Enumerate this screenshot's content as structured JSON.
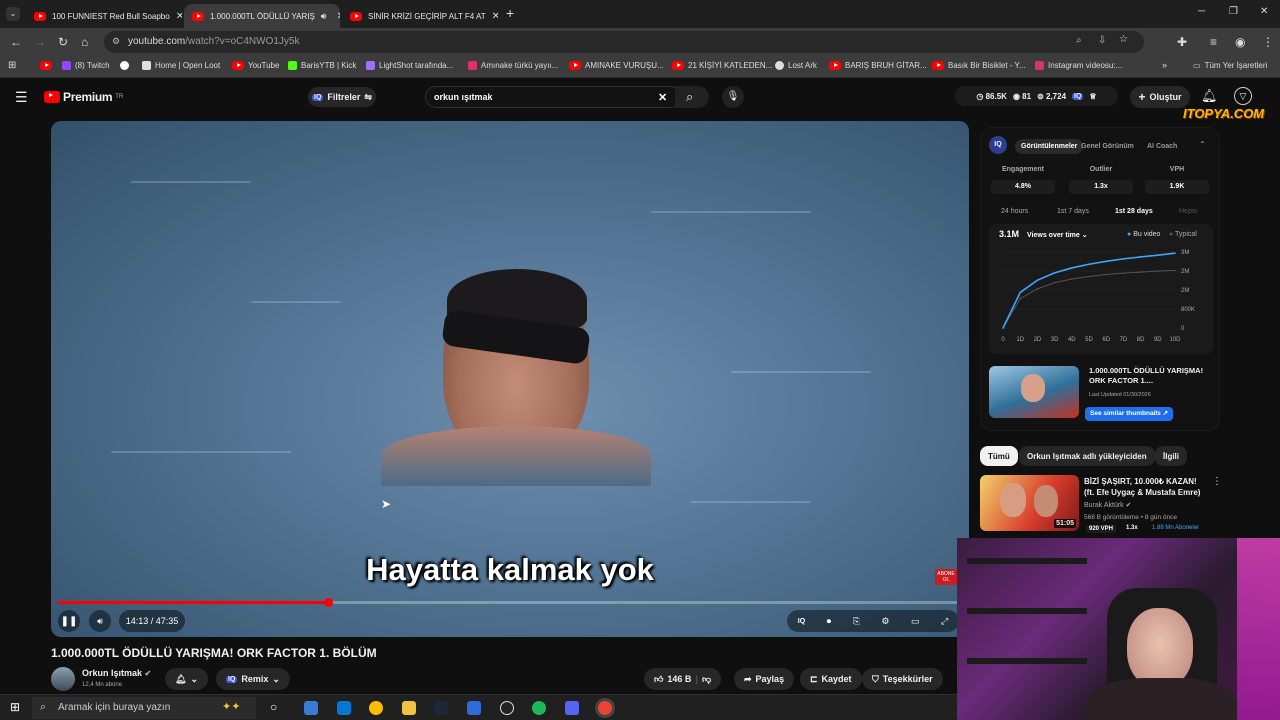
{
  "browser": {
    "tabs": [
      {
        "label": "100 FUNNIEST Red Bull Soapbo"
      },
      {
        "label": "1.000.000TL ÖDÜLLÜ YARIŞ"
      },
      {
        "label": "SİNİR KRİZİ GEÇİRİP ALT F4 AT"
      }
    ],
    "new_tab": "+",
    "url_host": "youtube.com",
    "url_path": "/watch?v=oC4NWO1Jy5k",
    "bookmarks": [
      {
        "label": "(8) Twitch",
        "color": "#9146ff"
      },
      {
        "label": "",
        "color": "#ffffff"
      },
      {
        "label": "Home | Open Loot",
        "color": "#dddddd"
      },
      {
        "label": "YouTube",
        "color": "#ff0000"
      },
      {
        "label": "BarisYTB | Kick",
        "color": "#53fc18"
      },
      {
        "label": "LightShot tarafında...",
        "color": "#a070ff"
      },
      {
        "label": "Amınake türkü yayıı...",
        "color": "#e1306c"
      },
      {
        "label": "AMINAKE VURUŞU...",
        "color": "#ff0000"
      },
      {
        "label": "21 KİŞİYİ KATLEDEN...",
        "color": "#ff0000"
      },
      {
        "label": "Lost Ark",
        "color": "#dddddd"
      },
      {
        "label": "BARIŞ BRUH GİTAR...",
        "color": "#ff0000"
      },
      {
        "label": "Basık Bir Bisiklet - Y...",
        "color": "#ff0000"
      },
      {
        "label": "Instagram videosu:...",
        "color": "#e1306c"
      }
    ],
    "all_bookmarks": "Tüm Yer İşaretleri"
  },
  "youtube": {
    "logo": "Premium",
    "logo_sup": "TR",
    "filters_label": "Filtreler",
    "search_value": "orkun ışıtmak",
    "stats": {
      "views": "86.5K",
      "eyes": "81",
      "subs": "2,724"
    },
    "create_label": "Oluştur",
    "watermark": "ITOPYA.COM"
  },
  "video": {
    "subtitle": "Hayatta kalmak yok",
    "time": "14:13 / 47:35",
    "progress": 0.299,
    "side_badge": "ABONE OL",
    "title": "1.000.000TL ÖDÜLLÜ YARIŞMA! ORK FACTOR 1. BÖLÜM",
    "channel": "Orkun Işıtmak",
    "subscribers": "12,4 Mn abone",
    "remix": "Remix",
    "likes": "146 B",
    "share": "Paylaş",
    "save": "Kaydet",
    "thanks": "Teşekkürler"
  },
  "panel": {
    "logo": "IQ",
    "tabs": [
      "Görüntülenmeler",
      "Genel Görünüm",
      "AI Coach"
    ],
    "metrics": [
      {
        "label": "Engagement",
        "value": "4.8%"
      },
      {
        "label": "Outlier",
        "value": "1.3x"
      },
      {
        "label": "VPH",
        "value": "1.9K"
      }
    ],
    "ranges": [
      "24 hours",
      "1st 7 days",
      "1st 28 days",
      "Hepsi"
    ],
    "total": "3.1M",
    "dropdown": "Views over time",
    "legend": [
      "Bu video",
      "Typical"
    ],
    "thumb_title": "1.000.000TL ÖDÜLLÜ YARIŞMA! ORK FACTOR 1....",
    "last_updated": "Last Updated 01/30/2026",
    "similar_btn": "See similar thumbnails"
  },
  "chart_data": {
    "type": "line",
    "x": [
      0,
      1,
      2,
      3,
      4,
      5,
      6,
      7,
      8,
      9,
      10
    ],
    "xticks": [
      "0",
      "1D",
      "2D",
      "3D",
      "4D",
      "5D",
      "6D",
      "7D",
      "8D",
      "9D",
      "10D"
    ],
    "yticks": [
      "3M",
      "2M",
      "2M",
      "800K",
      "0"
    ],
    "ylim": [
      0,
      3.1
    ],
    "series": [
      {
        "name": "Bu video",
        "values": [
          0,
          1.45,
          1.95,
          2.25,
          2.45,
          2.6,
          2.72,
          2.82,
          2.9,
          2.97,
          3.05
        ]
      },
      {
        "name": "Typical",
        "values": [
          0,
          1.2,
          1.6,
          1.85,
          2.0,
          2.1,
          2.18,
          2.24,
          2.28,
          2.32,
          2.35
        ]
      }
    ],
    "colors": {
      "Bu video": "#3ea6ff",
      "Typical": "#555555"
    }
  },
  "recommended": {
    "chips": [
      "Tümü",
      "Orkun Işıtmak adlı yükleyiciden",
      "İlgili"
    ],
    "item": {
      "title": "BİZİ ŞAŞIRT, 10.000₺ KAZAN! (ft. Efe Uygaç & Mustafa Emre)",
      "channel": "Burak Aktürk",
      "meta": "568 B görüntüleme • 8 gün önce",
      "duration": "51:05",
      "vph": "920 VPH",
      "outlier": "1.3x",
      "subs": "1.88 Mn Aboneler"
    }
  },
  "taskbar": {
    "search_placeholder": "Aramak için buraya yazın"
  }
}
